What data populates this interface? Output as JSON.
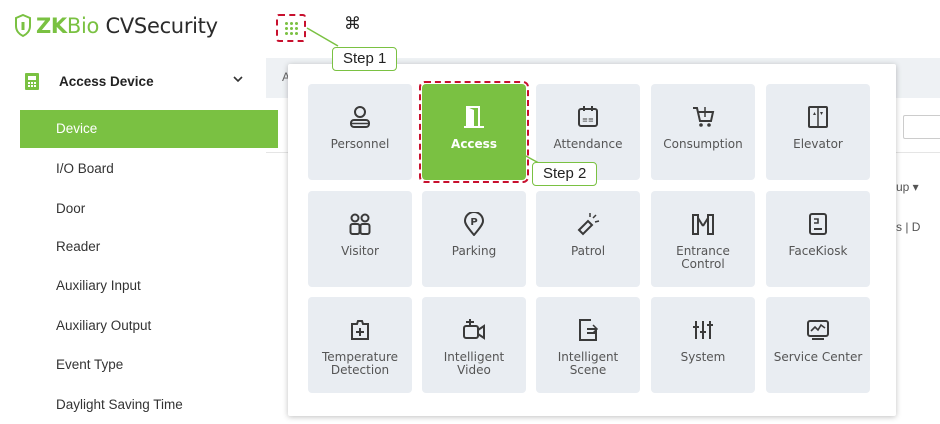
{
  "header": {
    "logo_zk": "ZK",
    "logo_bio": "Bio",
    "logo_cvs": " CVSecurity",
    "apps_icon": "apps-grid-icon",
    "cmd_icon": "command-icon",
    "cmd_glyph": "⌘"
  },
  "sidebar": {
    "group": {
      "label": "Access Device",
      "icon": "access-device-icon",
      "chevron": "⌄"
    },
    "items": [
      {
        "label": "Device",
        "active": true
      },
      {
        "label": "I/O Board"
      },
      {
        "label": "Door"
      },
      {
        "label": "Reader"
      },
      {
        "label": "Auxiliary Input"
      },
      {
        "label": "Auxiliary Output"
      },
      {
        "label": "Event Type"
      },
      {
        "label": "Daylight Saving Time"
      }
    ]
  },
  "background": {
    "crumb": "A",
    "partial_group": "up ▾",
    "partial_text": "s | D"
  },
  "panel": {
    "tiles": [
      {
        "id": "personnel",
        "label": "Personnel",
        "icon": "personnel-icon"
      },
      {
        "id": "access",
        "label": "Access",
        "icon": "access-door-icon",
        "active": true
      },
      {
        "id": "attendance",
        "label": "Attendance",
        "icon": "attendance-icon"
      },
      {
        "id": "consumption",
        "label": "Consumption",
        "icon": "consumption-icon"
      },
      {
        "id": "elevator",
        "label": "Elevator",
        "icon": "elevator-icon"
      },
      {
        "id": "visitor",
        "label": "Visitor",
        "icon": "visitor-icon"
      },
      {
        "id": "parking",
        "label": "Parking",
        "icon": "parking-icon"
      },
      {
        "id": "patrol",
        "label": "Patrol",
        "icon": "patrol-icon"
      },
      {
        "id": "entrance-control",
        "label": "Entrance\nControl",
        "icon": "entrance-control-icon"
      },
      {
        "id": "facekiosk",
        "label": "FaceKiosk",
        "icon": "facekiosk-icon"
      },
      {
        "id": "temperature-detection",
        "label": "Temperature\nDetection",
        "icon": "temperature-detection-icon"
      },
      {
        "id": "intelligent-video",
        "label": "Intelligent\nVideo",
        "icon": "intelligent-video-icon"
      },
      {
        "id": "intelligent-scene",
        "label": "Intelligent\nScene",
        "icon": "intelligent-scene-icon"
      },
      {
        "id": "system",
        "label": "System",
        "icon": "system-icon"
      },
      {
        "id": "service-center",
        "label": "Service Center",
        "icon": "service-center-icon"
      }
    ]
  },
  "steps": {
    "step1": "Step 1",
    "step2": "Step 2"
  },
  "colors": {
    "brand_green": "#7ac142",
    "highlight_red": "#c8102e",
    "tile_bg": "#e9edf2",
    "icon_dark": "#3a3a3a"
  }
}
